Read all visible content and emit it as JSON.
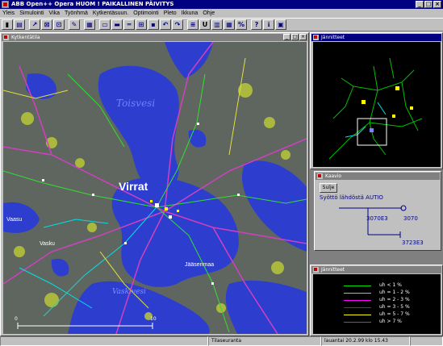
{
  "window": {
    "title": "ABB Open++ Opera HUOM ! PAIKALLINEN PÄIVITYS",
    "min": "_",
    "max": "□",
    "close": "×"
  },
  "menu": [
    "Yleis",
    "Simulointi",
    "Vika",
    "Työnhmä",
    "Kytkentäsuun.",
    "Optimointi",
    "Pleto",
    "Ikkuna",
    "Ohje"
  ],
  "toolbar": {
    "buttons": [
      "exit-icon",
      "print-icon",
      "zoom-in-icon",
      "zoom-out-icon",
      "select-icon",
      "pan-icon",
      "layer-icon",
      "grid-icon",
      "switch-icon",
      "line-icon",
      "node-icon",
      "feeder-icon",
      "undo-icon",
      "redo-icon",
      "list-icon",
      "u-label",
      "chart-icon",
      "table-icon",
      "percent-icon",
      "help-icon",
      "info-icon",
      "about-icon"
    ],
    "u_label": "U"
  },
  "map_window": {
    "title": "Kytkentätila",
    "labels": {
      "lake": "Toisvesi",
      "city": "Virrat",
      "village1": "Vaasu",
      "village2": "Jääsenmaa",
      "village3": "Vaskivesi",
      "village4": "Vasku"
    },
    "scale_start": "0",
    "scale_end": "10"
  },
  "overview_window": {
    "title": "Jännitteet"
  },
  "info_window": {
    "title": "Kaavio",
    "close_label": "Sulje",
    "heading": "Syöttö lähdöstä AUTIO",
    "value1": "3070E3",
    "value2": "3070",
    "value3": "3723E3"
  },
  "legend_window": {
    "title": "Jännitteet",
    "items": [
      {
        "label": "uh < 1 %",
        "color": "#00e000"
      },
      {
        "label": "uh = 1 - 2 %",
        "color": "#00ffff"
      },
      {
        "label": "uh = 2 - 3 %",
        "color": "#ff00ff"
      },
      {
        "label": "uh = 3 - 5 %",
        "color": "#3030ff"
      },
      {
        "label": "uh = 5 - 7 %",
        "color": "#ffff00"
      },
      {
        "label": "uh > 7 %",
        "color": "#ff2020"
      }
    ]
  },
  "status": {
    "left": "",
    "mid": "Tilaseuranta",
    "right1": "lauantai 20.2.99 klo 15.43",
    "right2": ""
  }
}
